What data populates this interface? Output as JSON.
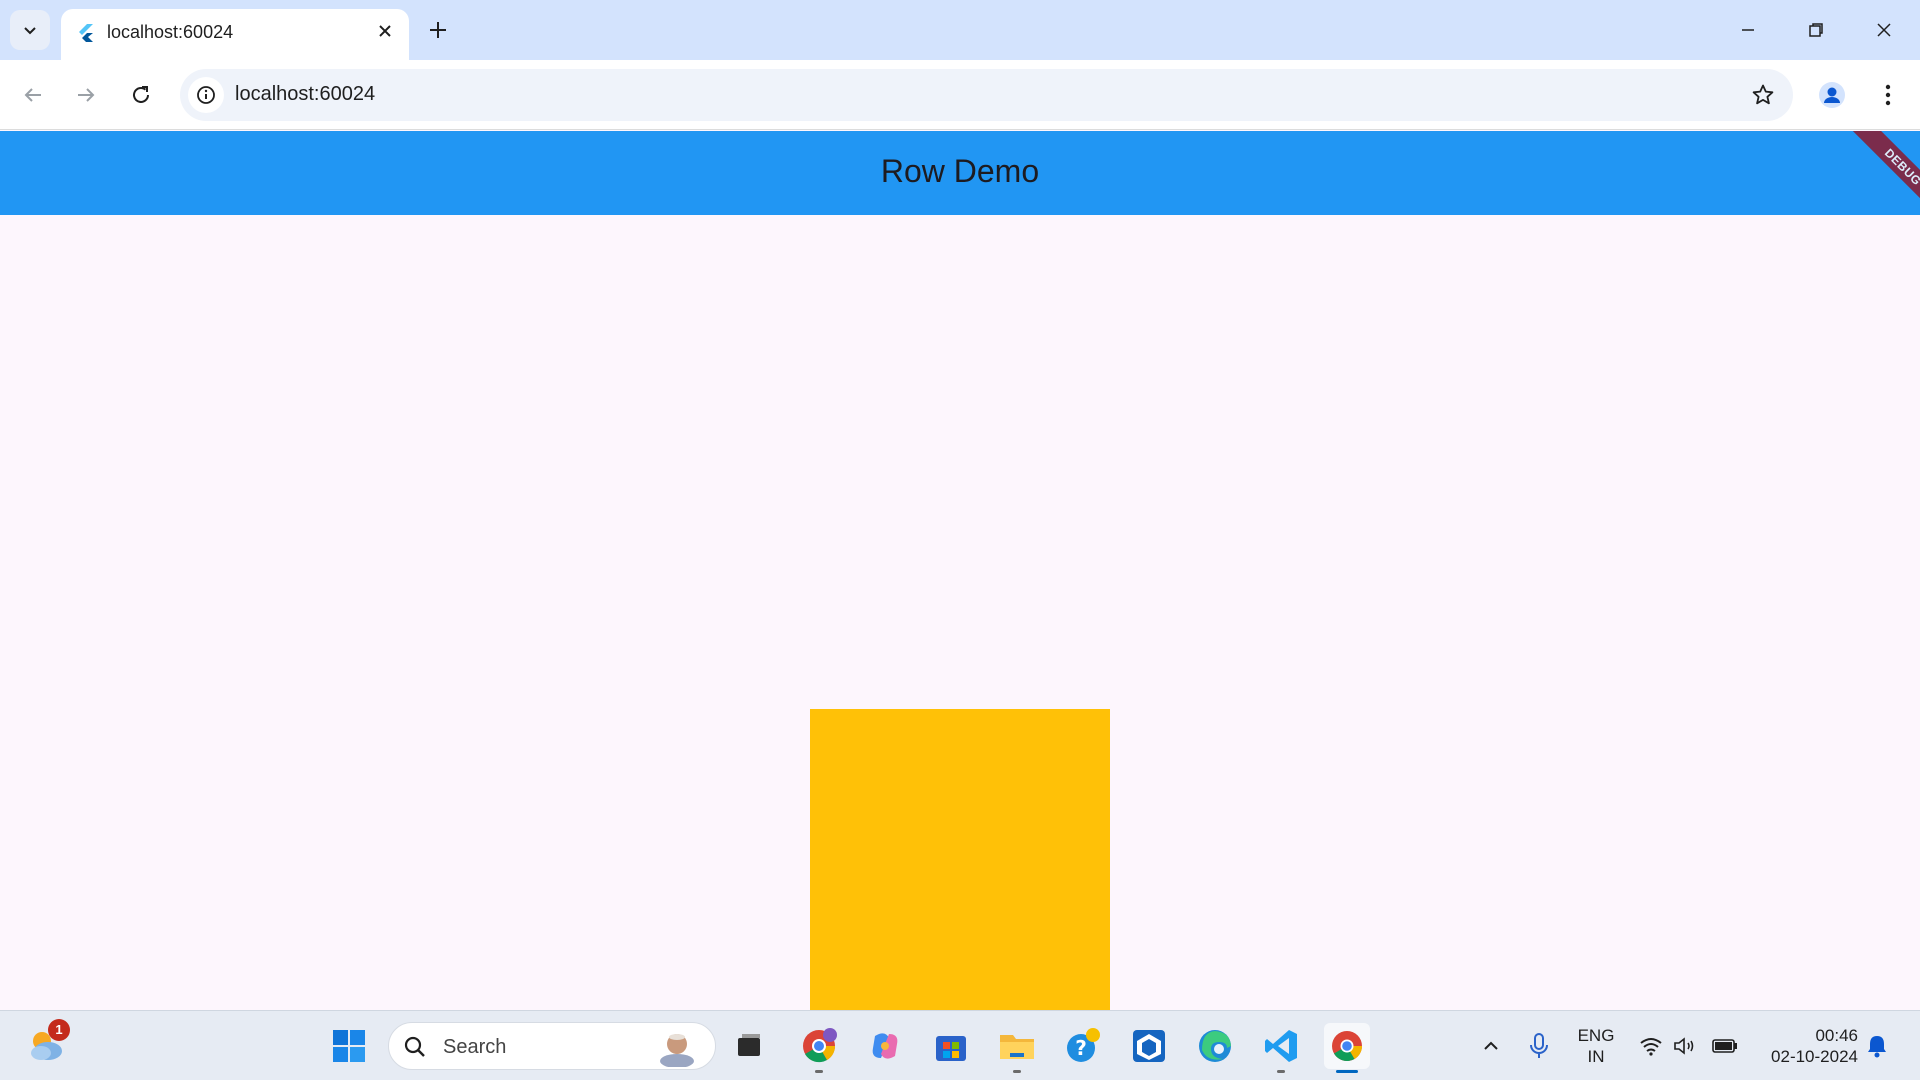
{
  "browser": {
    "tab_title": "localhost:60024",
    "url": "localhost:60024",
    "icons": {
      "tab_search": "chevron-down-icon",
      "favicon": "flutter-icon",
      "close_tab": "close-icon",
      "new_tab": "plus-icon",
      "back": "arrow-left-icon",
      "forward": "arrow-right-icon",
      "reload": "reload-icon",
      "site_info": "info-icon",
      "bookmark": "star-icon",
      "profile": "profile-icon",
      "menu": "kebab-menu-icon",
      "minimize": "minimize-icon",
      "restore": "restore-icon",
      "close_window": "close-icon"
    }
  },
  "app": {
    "title": "Row Demo",
    "debug_banner": "DEBUG",
    "colors": {
      "appbar": "#2196f3",
      "background": "#fdf6fd",
      "box": "#ffc107",
      "debug_banner": "#8b1a2f"
    }
  },
  "taskbar": {
    "search_placeholder": "Search",
    "weather_badge": "1",
    "language": [
      "ENG",
      "IN"
    ],
    "time": "00:46",
    "date": "02-10-2024",
    "apps": [
      "start",
      "search",
      "task-view",
      "chrome-profile",
      "copilot",
      "microsoft-store",
      "file-explorer",
      "get-help",
      "app",
      "edge",
      "vscode",
      "chrome"
    ]
  }
}
